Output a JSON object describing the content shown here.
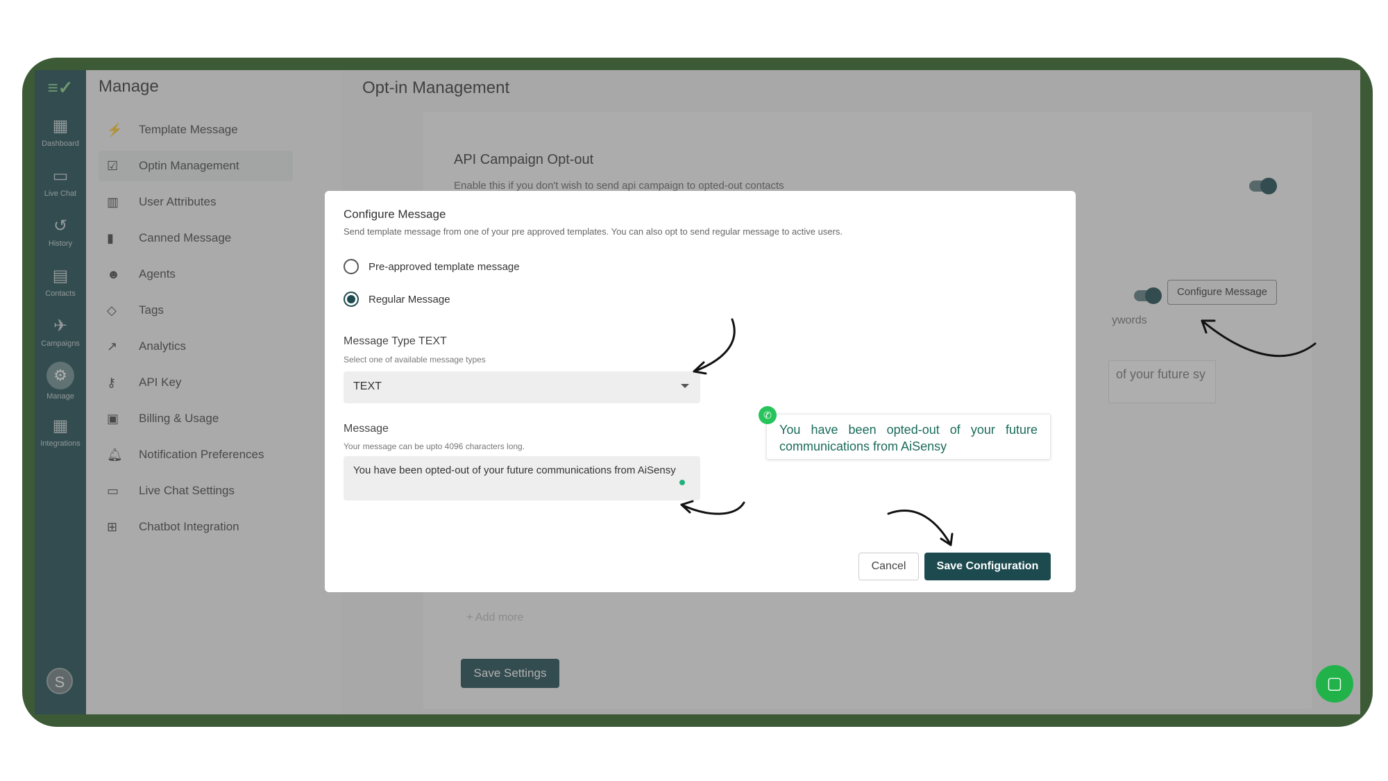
{
  "rail": {
    "items": [
      {
        "icon": "dashboard-icon",
        "label": "Dashboard"
      },
      {
        "icon": "chat-icon",
        "label": "Live Chat"
      },
      {
        "icon": "history-icon",
        "label": "History"
      },
      {
        "icon": "contacts-icon",
        "label": "Contacts"
      },
      {
        "icon": "campaigns-icon",
        "label": "Campaigns"
      },
      {
        "icon": "gear-icon",
        "label": "Manage"
      },
      {
        "icon": "integrations-icon",
        "label": "Integrations"
      }
    ],
    "avatar": "S"
  },
  "sidebar": {
    "title": "Manage",
    "items": [
      {
        "icon": "bolt-icon",
        "label": "Template Message"
      },
      {
        "icon": "checkbox-icon",
        "label": "Optin Management"
      },
      {
        "icon": "columns-icon",
        "label": "User Attributes"
      },
      {
        "icon": "bookmark-icon",
        "label": "Canned Message"
      },
      {
        "icon": "people-icon",
        "label": "Agents"
      },
      {
        "icon": "tag-icon",
        "label": "Tags"
      },
      {
        "icon": "trend-icon",
        "label": "Analytics"
      },
      {
        "icon": "key-icon",
        "label": "API Key"
      },
      {
        "icon": "billing-icon",
        "label": "Billing & Usage"
      },
      {
        "icon": "bell-icon",
        "label": "Notification Preferences"
      },
      {
        "icon": "message-icon",
        "label": "Live Chat Settings"
      },
      {
        "icon": "plus-box-icon",
        "label": "Chatbot Integration"
      }
    ]
  },
  "main": {
    "title": "Opt-in Management",
    "api_title": "API Campaign Opt-out",
    "api_sub": "Enable this if you don't wish to send api campaign to opted-out contacts",
    "configure_label": "Configure Message",
    "keywords_fragment": "ywords",
    "bubble_fragment": "of your future sy",
    "add_more": "Add more",
    "save_settings": "Save Settings"
  },
  "modal": {
    "title": "Configure Message",
    "subtitle": "Send template message from one of your pre approved templates. You can also opt to send regular message to active users.",
    "radio_template": "Pre-approved template message",
    "radio_regular": "Regular Message",
    "type_label": "Message Type TEXT",
    "type_help": "Select one of available message types",
    "type_value": "TEXT",
    "message_label": "Message",
    "message_help": "Your message can be upto 4096 characters long.",
    "message_value": "You have been opted-out of your future communications from AiSensy",
    "preview_text": "You have been opted-out of your future communications from AiSensy",
    "cancel": "Cancel",
    "save": "Save Configuration"
  },
  "colors": {
    "brand": "#1d4a4f",
    "accent": "#26c45a",
    "frame": "#3d5a36"
  }
}
